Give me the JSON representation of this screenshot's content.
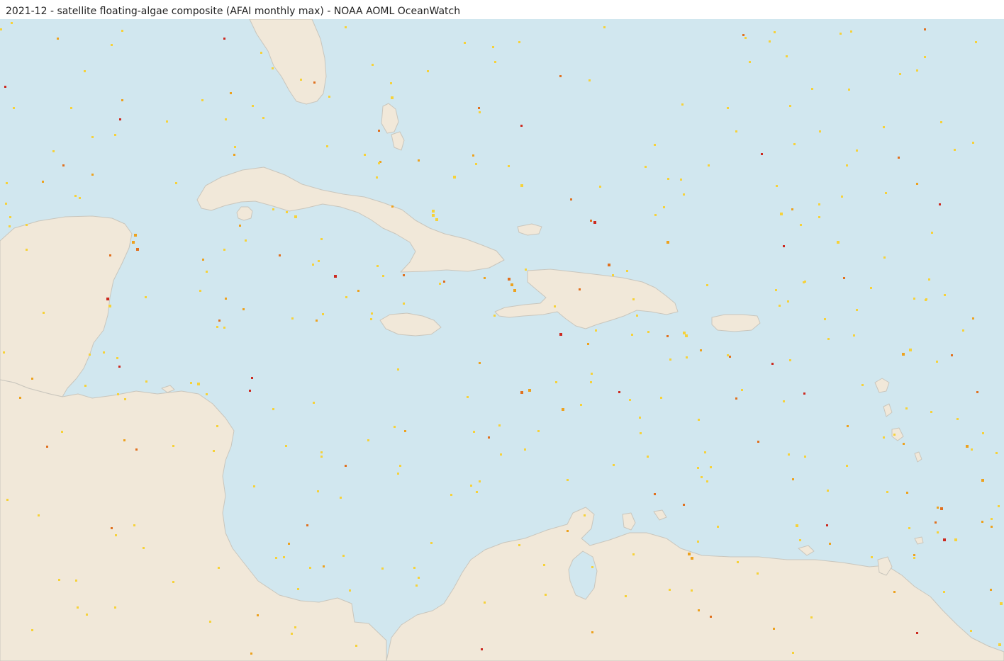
{
  "window": {
    "title": "2021-12 - satellite floating-algae composite (AFAI monthly max) - NOAA AOML OceanWatch"
  },
  "colors": {
    "ocean": "#d1e7ef",
    "land": "#f1e8d9",
    "coast": "#c9c6bd",
    "algae_low": "#f6d23a",
    "algae_mid": "#eda21f",
    "algae_high": "#e07120",
    "algae_max": "#cc2a20"
  },
  "icons": [
    "algae-pixel"
  ]
}
